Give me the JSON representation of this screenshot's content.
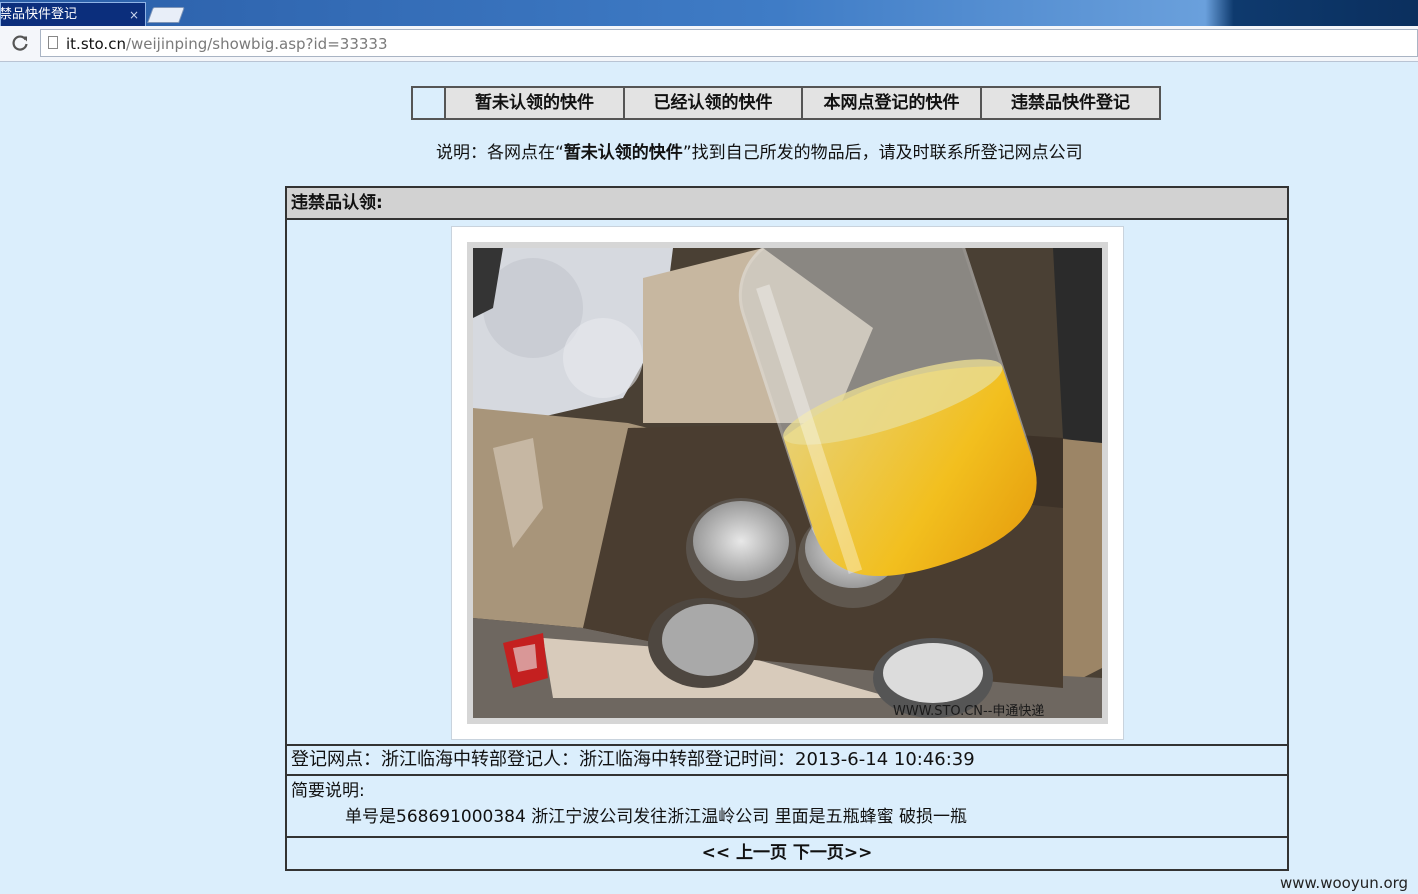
{
  "browser": {
    "tab_title": "禁品快件登记",
    "tab_close": "×",
    "url_domain": "it.sto.cn",
    "url_path": "/weijinping/showbig.asp?id=33333"
  },
  "nav": {
    "items": [
      "暂未认领的快件",
      "已经认领的快件",
      "本网点登记的快件",
      "违禁品快件登记"
    ]
  },
  "notice": {
    "prefix": "说明：各网点在“",
    "highlight": "暂未认领的快件",
    "suffix": "”找到自己所发的物品后，请及时联系所登记网点公司"
  },
  "panel": {
    "header": "违禁品认领:",
    "photo_watermark": "WWW.STO.CN--申通快递",
    "info": "登记网点：浙江临海中转部登记人：浙江临海中转部登记时间：2013-6-14 10:46:39",
    "desc_label": "简要说明:",
    "desc_text": "单号是568691000384 浙江宁波公司发往浙江温岭公司 里面是五瓶蜂蜜 破损一瓶",
    "prev": "<< 上一页",
    "next": "下一页>>"
  },
  "footer_watermark": "www.wooyun.org"
}
